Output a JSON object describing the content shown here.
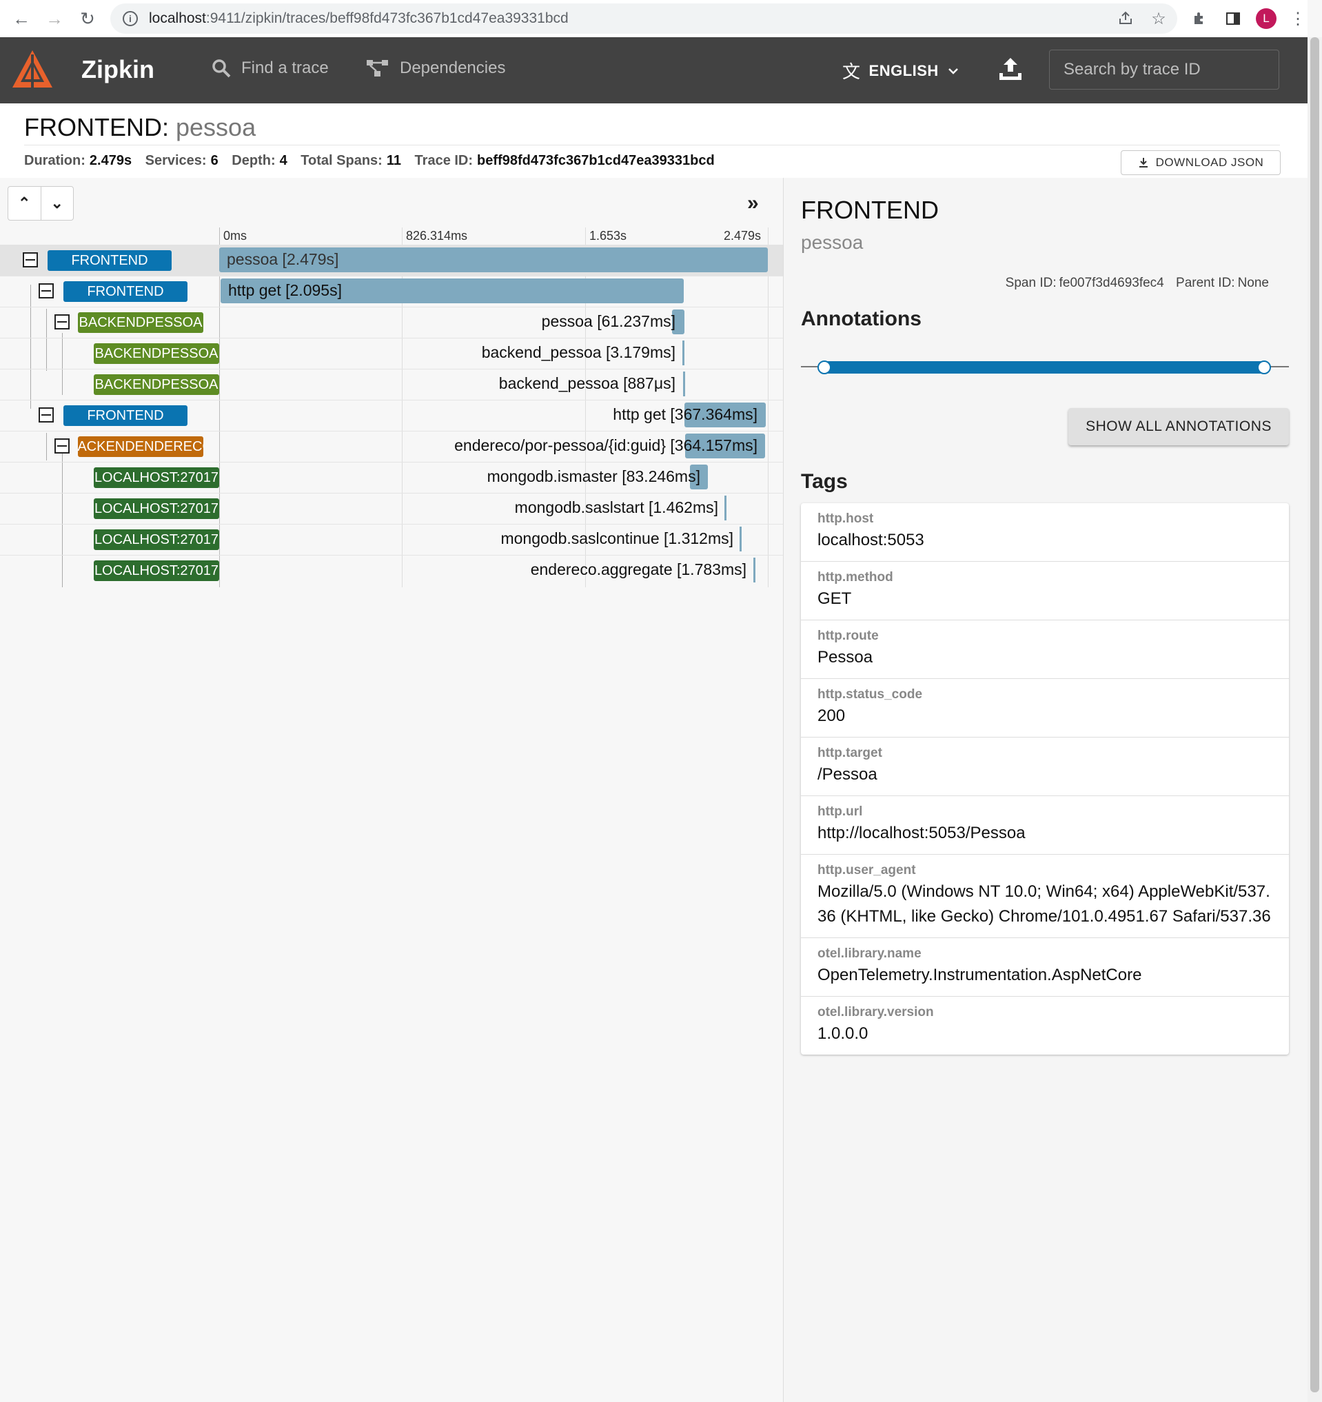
{
  "browser": {
    "url_host": "localhost",
    "url_rest": ":9411/zipkin/traces/beff98fd473fc367b1cd47ea39331bcd",
    "avatar_letter": "L"
  },
  "header": {
    "brand": "Zipkin",
    "find_trace": "Find a trace",
    "dependencies": "Dependencies",
    "language": "ENGLISH",
    "search_placeholder": "Search by trace ID"
  },
  "summary": {
    "service": "FRONTEND:",
    "span": "pessoa",
    "duration_label": "Duration:",
    "duration": "2.479s",
    "services_label": "Services:",
    "services": "6",
    "depth_label": "Depth:",
    "depth": "4",
    "total_spans_label": "Total Spans:",
    "total_spans": "11",
    "trace_id_label": "Trace ID:",
    "trace_id": "beff98fd473fc367b1cd47ea39331bcd",
    "download": "DOWNLOAD JSON"
  },
  "timeline": {
    "ticks": [
      "0ms",
      "826.314ms",
      "1.653s",
      "2.479s"
    ],
    "rows": [
      {
        "service": "FRONTEND",
        "label": "pessoa [2.479s]",
        "color": "#0a74b1"
      },
      {
        "service": "FRONTEND",
        "label": "http get [2.095s]",
        "color": "#0a74b1"
      },
      {
        "service": "BACKENDPESSOA",
        "label": "pessoa [61.237ms]",
        "color": "#5e8c24"
      },
      {
        "service": "BACKENDPESSOA",
        "label": "backend_pessoa [3.179ms]",
        "color": "#5e8c24"
      },
      {
        "service": "BACKENDPESSOA",
        "label": "backend_pessoa [887μs]",
        "color": "#5e8c24"
      },
      {
        "service": "FRONTEND",
        "label": "http get [367.364ms]",
        "color": "#0a74b1"
      },
      {
        "service": "BACKENDENDERECO",
        "label": "endereco/por-pessoa/{id:guid} [364.157ms]",
        "color": "#c06a0b"
      },
      {
        "service": "LOCALHOST:27017",
        "label": "mongodb.ismaster [83.246ms]",
        "color": "#2d6d2e"
      },
      {
        "service": "LOCALHOST:27017",
        "label": "mongodb.saslstart [1.462ms]",
        "color": "#2d6d2e"
      },
      {
        "service": "LOCALHOST:27017",
        "label": "mongodb.saslcontinue [1.312ms]",
        "color": "#2d6d2e"
      },
      {
        "service": "LOCALHOST:27017",
        "label": "endereco.aggregate [1.783ms]",
        "color": "#2d6d2e"
      }
    ]
  },
  "detail": {
    "service": "FRONTEND",
    "span": "pessoa",
    "span_id_label": "Span ID:",
    "span_id": "fe007f3d4693fec4",
    "parent_id_label": "Parent ID:",
    "parent_id": "None",
    "annotations_title": "Annotations",
    "show_all": "SHOW ALL ANNOTATIONS",
    "tags_title": "Tags",
    "tags": [
      {
        "key": "http.host",
        "value": "localhost:5053"
      },
      {
        "key": "http.method",
        "value": "GET"
      },
      {
        "key": "http.route",
        "value": "Pessoa"
      },
      {
        "key": "http.status_code",
        "value": "200"
      },
      {
        "key": "http.target",
        "value": "/Pessoa"
      },
      {
        "key": "http.url",
        "value": "http://localhost:5053/Pessoa"
      },
      {
        "key": "http.user_agent",
        "value": "Mozilla/5.0 (Windows NT 10.0; Win64; x64) AppleWebKit/537.36 (KHTML, like Gecko) Chrome/101.0.4951.67 Safari/537.36"
      },
      {
        "key": "otel.library.name",
        "value": "OpenTelemetry.Instrumentation.AspNetCore"
      },
      {
        "key": "otel.library.version",
        "value": "1.0.0.0"
      }
    ]
  }
}
